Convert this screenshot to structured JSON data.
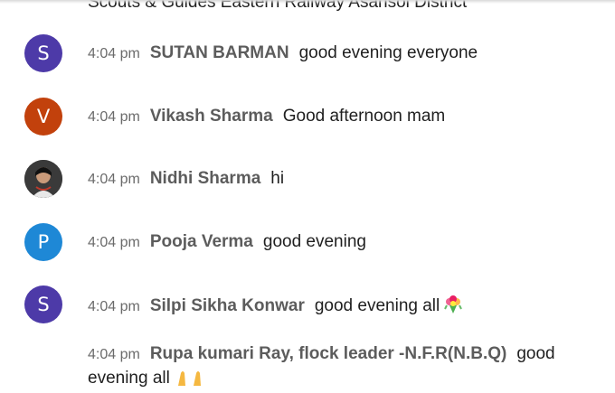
{
  "header": {
    "title": "Scouts & Guides Eastern Railway Asansol District"
  },
  "messages": [
    {
      "initial": "S",
      "color": "#4d3aa8",
      "time": "4:04 pm",
      "author": "SUTAN BARMAN",
      "text": "good evening everyone"
    },
    {
      "initial": "V",
      "color": "#c2410c",
      "time": "4:04 pm",
      "author": "Vikash Sharma",
      "text": "Good afternoon mam"
    },
    {
      "initial": "",
      "color": "#2b2b2b",
      "time": "4:04 pm",
      "author": "Nidhi Sharma",
      "text": "hi"
    },
    {
      "initial": "P",
      "color": "#1e88d6",
      "time": "4:04 pm",
      "author": "Pooja Verma",
      "text": "good evening"
    },
    {
      "initial": "S",
      "color": "#4d3aa8",
      "time": "4:04 pm",
      "author": "Silpi Sikha Konwar",
      "text": "good evening all",
      "emoji": "bouquet-icon"
    },
    {
      "time": "4:04 pm",
      "author": "Rupa kumari Ray, flock leader -N.F.R(N.B.Q)",
      "text_line1": "good",
      "text_line2": "evening all",
      "emoji": "folded-hands-icon"
    }
  ]
}
